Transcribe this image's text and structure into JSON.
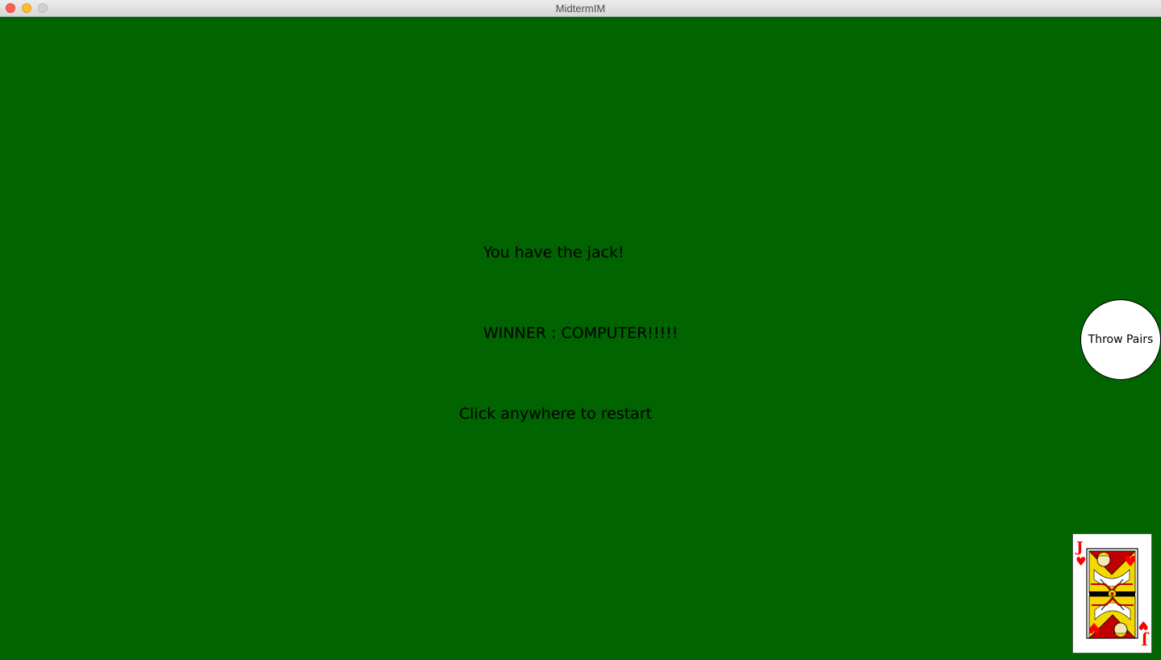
{
  "window": {
    "title": "MidtermIM"
  },
  "game": {
    "message_jack": "You have the jack!",
    "message_winner": "WINNER : COMPUTER!!!!!",
    "message_restart": "Click anywhere to restart",
    "throw_pairs_label": "Throw Pairs",
    "card": {
      "rank": "J",
      "suit": "hearts",
      "suit_symbol": "♥"
    }
  },
  "colors": {
    "table": "#006400",
    "card_red": "#ff0000",
    "button_bg": "#ffffff"
  }
}
